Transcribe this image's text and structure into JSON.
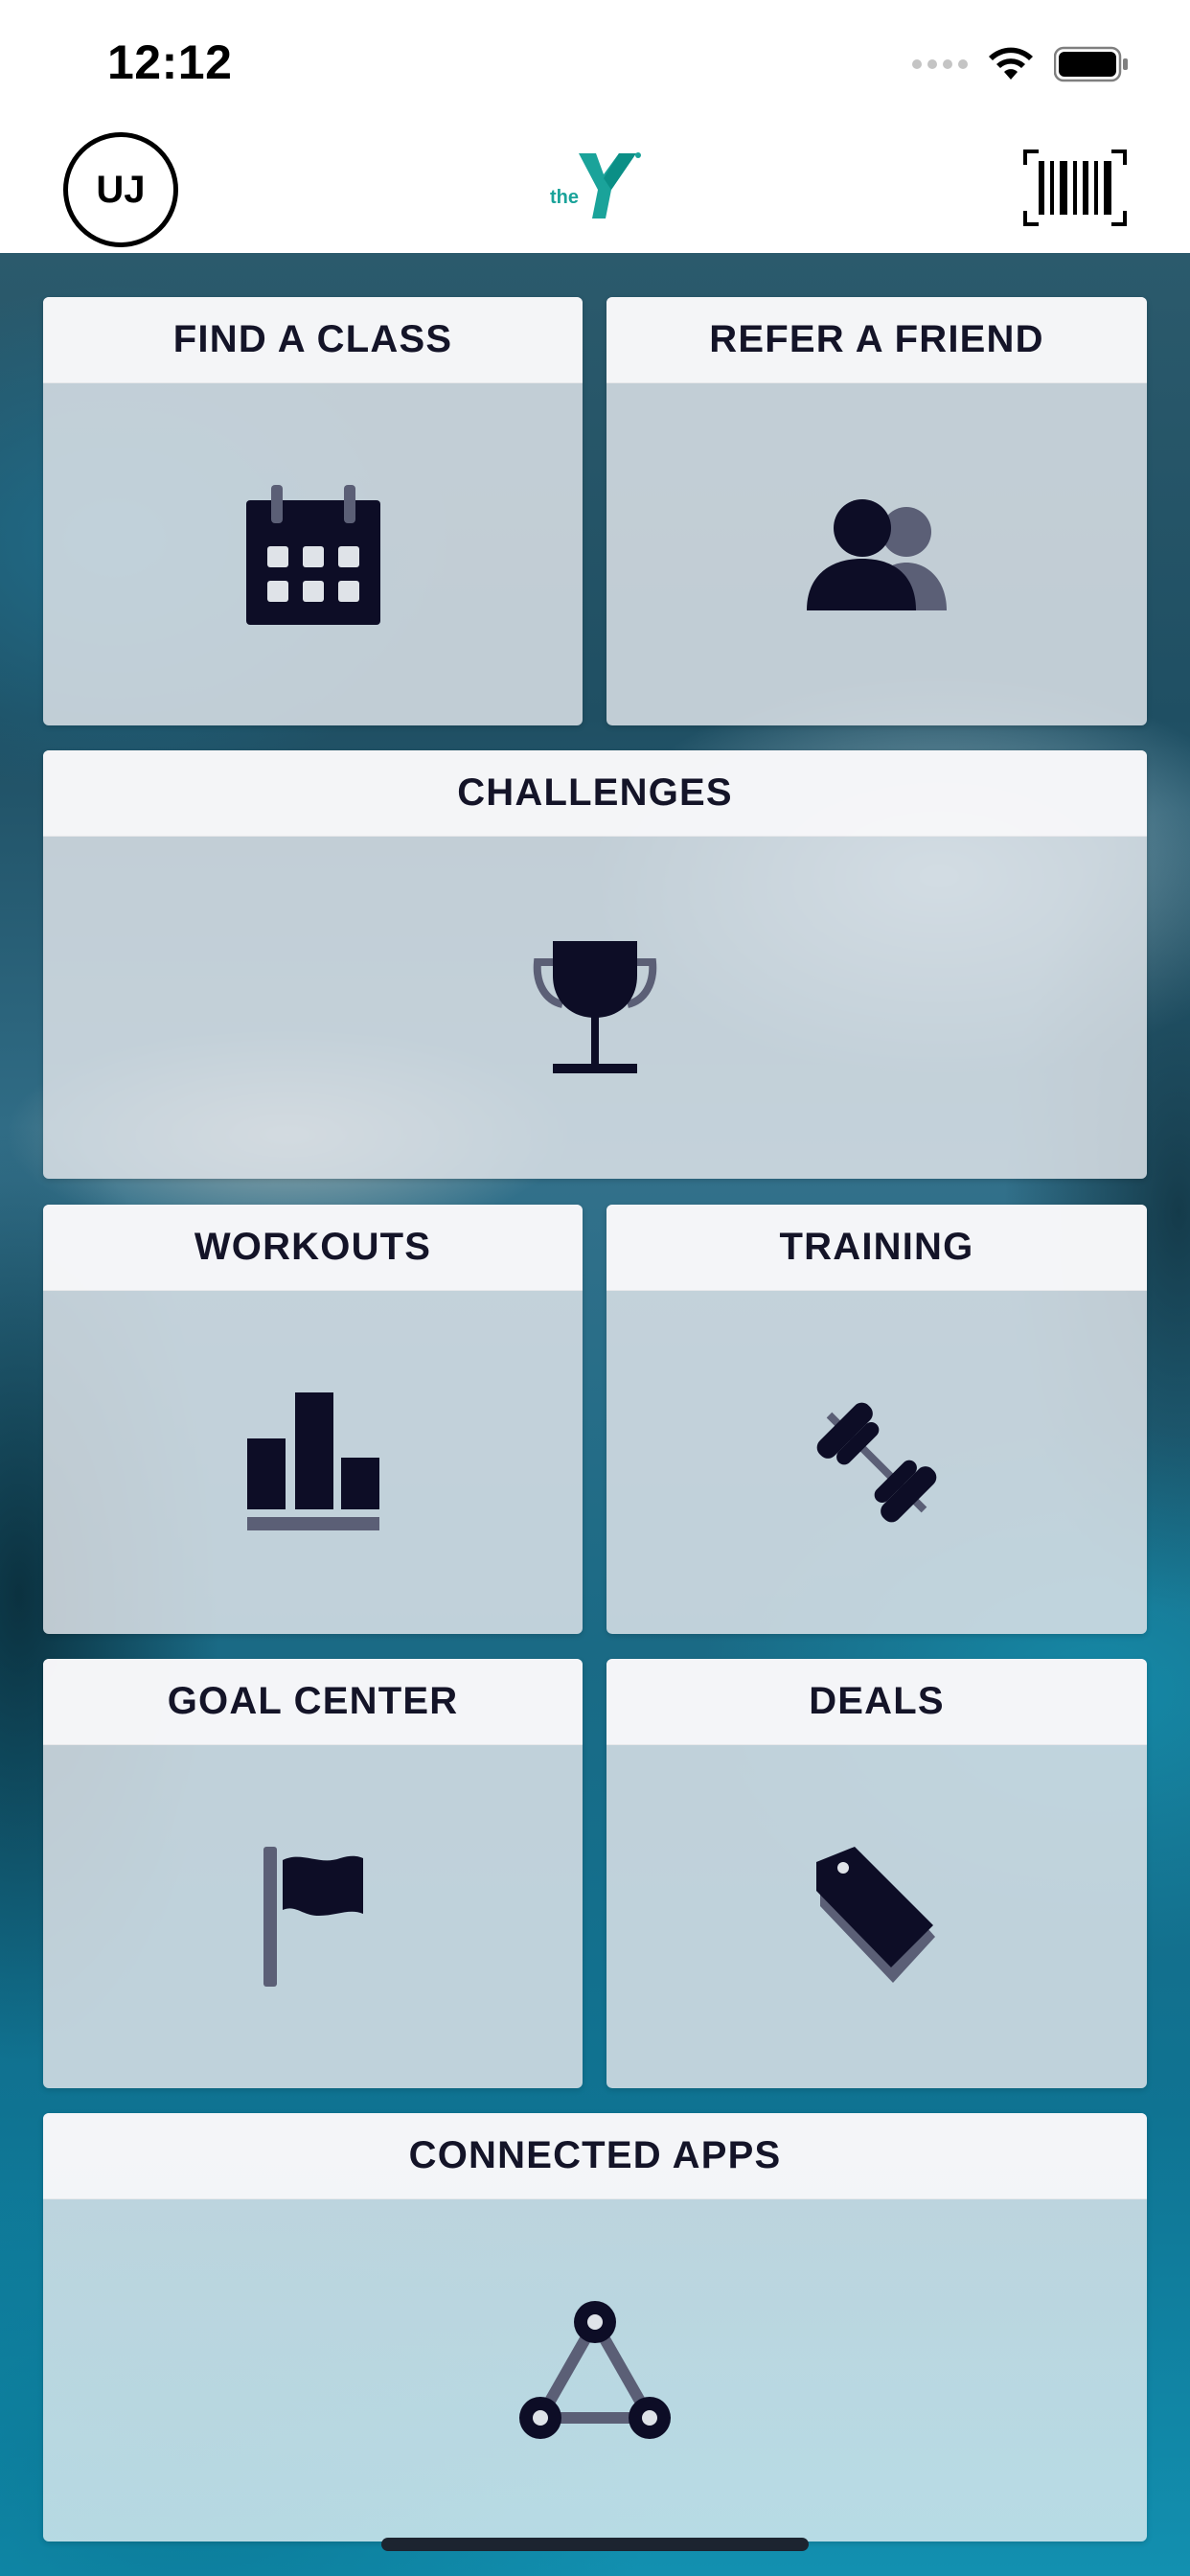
{
  "status_bar": {
    "time": "12:12"
  },
  "header": {
    "avatar_initials": "UJ",
    "logo_text": "the",
    "brand_color": "#1aa39a",
    "brand_dark": "#0b8f86"
  },
  "tiles": [
    {
      "label": "FIND A CLASS",
      "icon": "calendar-icon"
    },
    {
      "label": "REFER A FRIEND",
      "icon": "people-icon"
    },
    {
      "label": "CHALLENGES",
      "icon": "trophy-icon"
    },
    {
      "label": "WORKOUTS",
      "icon": "bar-chart-icon"
    },
    {
      "label": "TRAINING",
      "icon": "dumbbell-icon"
    },
    {
      "label": "GOAL CENTER",
      "icon": "flag-icon"
    },
    {
      "label": "DEALS",
      "icon": "tag-icon"
    },
    {
      "label": "CONNECTED APPS",
      "icon": "network-icon"
    }
  ],
  "colors": {
    "icon_primary": "#0d0d26",
    "icon_secondary": "#5b5f76"
  }
}
